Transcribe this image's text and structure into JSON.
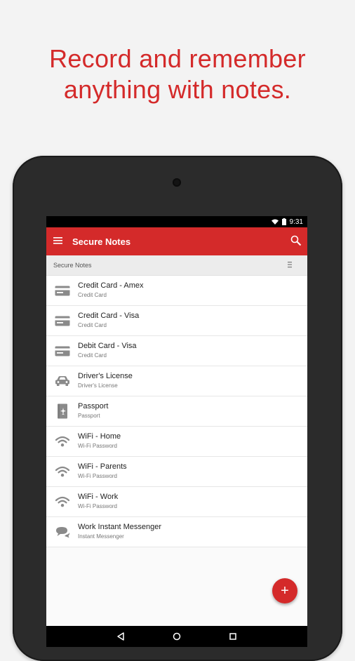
{
  "headline": {
    "line1": "Record and remember",
    "line2": "anything with notes."
  },
  "status": {
    "time": "9:31"
  },
  "appbar": {
    "title": "Secure Notes"
  },
  "subheader": {
    "label": "Secure Notes"
  },
  "notes": [
    {
      "title": "Credit Card - Amex",
      "subtitle": "Credit Card",
      "icon": "credit-card-icon"
    },
    {
      "title": "Credit Card - Visa",
      "subtitle": "Credit Card",
      "icon": "credit-card-icon"
    },
    {
      "title": "Debit Card - Visa",
      "subtitle": "Credit Card",
      "icon": "credit-card-icon"
    },
    {
      "title": "Driver's License",
      "subtitle": "Driver's License",
      "icon": "car-icon"
    },
    {
      "title": "Passport",
      "subtitle": "Passport",
      "icon": "passport-icon"
    },
    {
      "title": "WiFi - Home",
      "subtitle": "Wi-Fi Password",
      "icon": "wifi-icon"
    },
    {
      "title": "WiFi - Parents",
      "subtitle": "Wi-Fi Password",
      "icon": "wifi-icon"
    },
    {
      "title": "WiFi - Work",
      "subtitle": "Wi-Fi Password",
      "icon": "wifi-icon"
    },
    {
      "title": "Work Instant Messenger",
      "subtitle": "Instant Messenger",
      "icon": "chat-bubbles-icon"
    }
  ],
  "fab": {
    "label": "+"
  },
  "colors": {
    "accent": "#d42a2a",
    "icon_gray": "#8a8a8a"
  }
}
